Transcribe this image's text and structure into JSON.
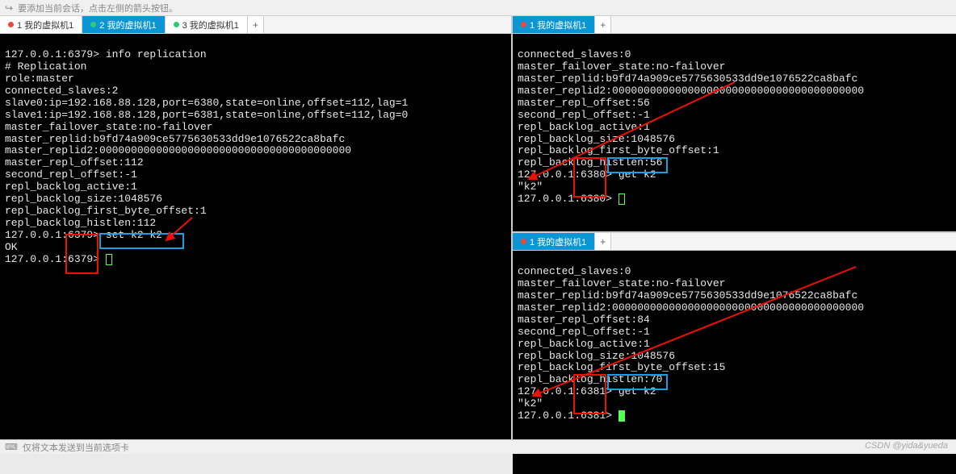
{
  "top_hint": "要添加当前会话，点击左侧的箭头按钮。",
  "bottom_hint": "仅将文本发送到当前选项卡",
  "watermark": "CSDN @yida&yueda",
  "left": {
    "tabs": [
      {
        "label": "1 我的虚拟机1",
        "active": false,
        "color": "red"
      },
      {
        "label": "2 我的虚拟机1",
        "active": true,
        "color": "green"
      },
      {
        "label": "3 我的虚拟机1",
        "active": false,
        "color": "green"
      }
    ],
    "terminal": {
      "prompt1": "127.0.0.1:6379> ",
      "cmd1": "info replication",
      "lines": [
        "# Replication",
        "role:master",
        "connected_slaves:2",
        "slave0:ip=192.168.88.128,port=6380,state=online,offset=112,lag=1",
        "slave1:ip=192.168.88.128,port=6381,state=online,offset=112,lag=0",
        "master_failover_state:no-failover",
        "master_replid:b9fd74a909ce5775630533dd9e1076522ca8bafc",
        "master_replid2:0000000000000000000000000000000000000000",
        "master_repl_offset:112",
        "second_repl_offset:-1",
        "repl_backlog_active:1",
        "repl_backlog_size:1048576",
        "repl_backlog_first_byte_offset:1",
        "repl_backlog_histlen:112"
      ],
      "prompt2": "127.0.0.1:6379> ",
      "cmd2": "set k2 k2",
      "result2": "OK",
      "prompt3": "127.0.0.1:6379> "
    }
  },
  "right_top": {
    "tabs": [
      {
        "label": "1 我的虚拟机1",
        "active": true,
        "color": "red"
      }
    ],
    "terminal": {
      "lines": [
        "connected_slaves:0",
        "master_failover_state:no-failover",
        "master_replid:b9fd74a909ce5775630533dd9e1076522ca8bafc",
        "master_replid2:0000000000000000000000000000000000000000",
        "master_repl_offset:56",
        "second_repl_offset:-1",
        "repl_backlog_active:1",
        "repl_backlog_size:1048576",
        "repl_backlog_first_byte_offset:1",
        "repl_backlog_histlen:56"
      ],
      "prompt1": "127.0.0.1:6380> ",
      "cmd1": "get k2",
      "result1": "\"k2\"",
      "prompt2": "127.0.0.1:6380> "
    }
  },
  "right_bottom": {
    "tabs": [
      {
        "label": "1 我的虚拟机1",
        "active": true,
        "color": "red"
      }
    ],
    "terminal": {
      "lines": [
        "connected_slaves:0",
        "master_failover_state:no-failover",
        "master_replid:b9fd74a909ce5775630533dd9e1076522ca8bafc",
        "master_replid2:0000000000000000000000000000000000000000",
        "master_repl_offset:84",
        "second_repl_offset:-1",
        "repl_backlog_active:1",
        "repl_backlog_size:1048576",
        "repl_backlog_first_byte_offset:15",
        "repl_backlog_histlen:70"
      ],
      "prompt1": "127.0.0.1:6381> ",
      "cmd1": "get k2",
      "result1": "\"k2\"",
      "prompt2": "127.0.0.1:6381> "
    }
  }
}
